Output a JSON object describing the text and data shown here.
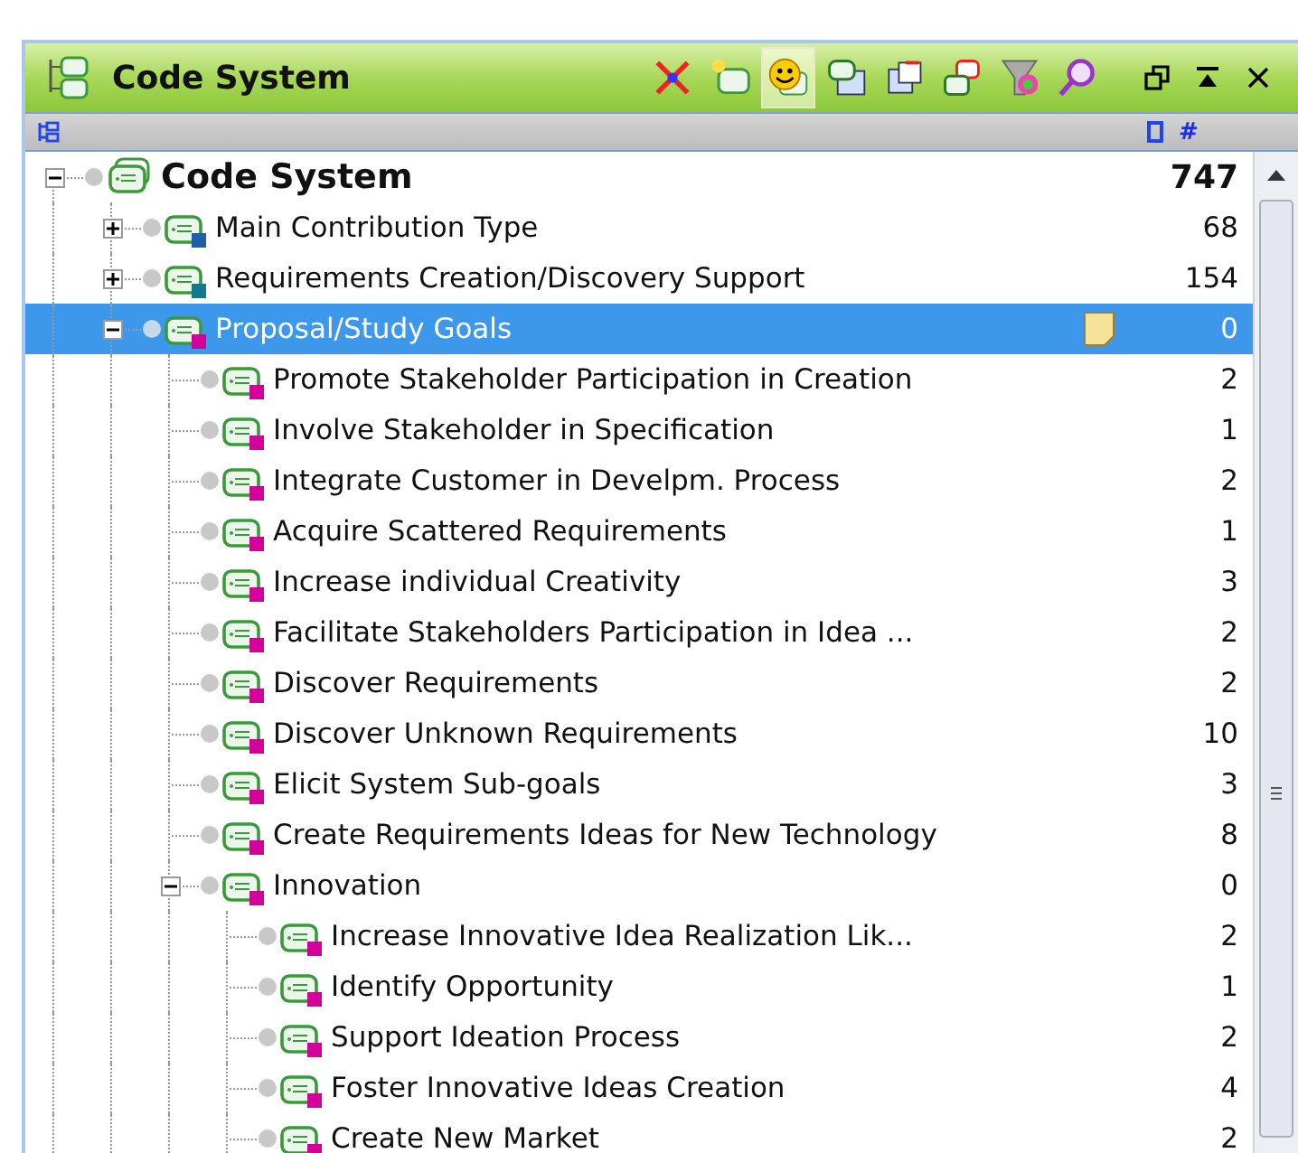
{
  "window": {
    "title": "Code System"
  },
  "header": {
    "count_column": "#"
  },
  "tree": {
    "label": "Code System",
    "count": "747",
    "selected": false,
    "expanded": true,
    "children": [
      {
        "label": "Main Contribution Type",
        "count": "68",
        "selected": false,
        "expanded": false,
        "color": "#1f5fa8"
      },
      {
        "label": "Requirements Creation/Discovery Support",
        "count": "154",
        "selected": false,
        "expanded": false,
        "color": "#127a8c"
      },
      {
        "label": "Proposal/Study Goals",
        "count": "0",
        "selected": true,
        "expanded": true,
        "memo": true,
        "color": "#d1009a",
        "children": [
          {
            "label": "Promote Stakeholder Participation in Creation",
            "count": "2",
            "selected": false,
            "color": "#d1009a"
          },
          {
            "label": "Involve Stakeholder in Specification",
            "count": "1",
            "selected": false,
            "color": "#d1009a"
          },
          {
            "label": "Integrate Customer in Develpm. Process",
            "count": "2",
            "selected": false,
            "color": "#d1009a"
          },
          {
            "label": "Acquire Scattered Requirements",
            "count": "1",
            "selected": false,
            "color": "#d1009a"
          },
          {
            "label": "Increase individual Creativity",
            "count": "3",
            "selected": false,
            "color": "#d1009a"
          },
          {
            "label": "Facilitate Stakeholders Participation in Idea ...",
            "count": "2",
            "selected": false,
            "color": "#d1009a"
          },
          {
            "label": "Discover Requirements",
            "count": "2",
            "selected": false,
            "color": "#d1009a"
          },
          {
            "label": "Discover Unknown Requirements",
            "count": "10",
            "selected": false,
            "color": "#d1009a"
          },
          {
            "label": "Elicit System Sub-goals",
            "count": "3",
            "selected": false,
            "color": "#d1009a"
          },
          {
            "label": "Create  Requirements Ideas for New Technology",
            "count": "8",
            "selected": false,
            "color": "#d1009a"
          },
          {
            "label": "Innovation",
            "count": "0",
            "selected": false,
            "expanded": true,
            "color": "#d1009a",
            "children": [
              {
                "label": "Increase Innovative Idea Realization Lik...",
                "count": "2",
                "selected": false,
                "color": "#d1009a"
              },
              {
                "label": "Identify Opportunity",
                "count": "1",
                "selected": false,
                "color": "#d1009a"
              },
              {
                "label": "Support Ideation Process",
                "count": "2",
                "selected": false,
                "color": "#d1009a"
              },
              {
                "label": "Foster Innovative Ideas Creation",
                "count": "4",
                "selected": false,
                "color": "#d1009a"
              },
              {
                "label": "Create New Market",
                "count": "2",
                "selected": false,
                "color": "#d1009a"
              }
            ]
          }
        ]
      }
    ]
  }
}
